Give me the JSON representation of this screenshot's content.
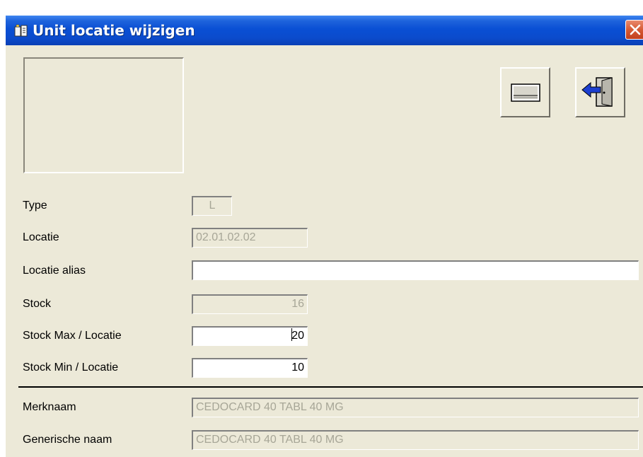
{
  "window": {
    "title": "Unit locatie wijzigen",
    "title_icon": "unit-location-icon",
    "close_icon": "close-icon"
  },
  "toolbar": {
    "save_icon": "save-icon",
    "exit_icon": "exit-door-icon"
  },
  "form": {
    "type": {
      "label": "Type",
      "value": "L"
    },
    "locatie": {
      "label": "Locatie",
      "value": "02.01.02.02"
    },
    "locatie_alias": {
      "label": "Locatie alias",
      "value": ""
    },
    "stock": {
      "label": "Stock",
      "value": "16"
    },
    "stock_max": {
      "label": "Stock Max / Locatie",
      "value": "20"
    },
    "stock_min": {
      "label": "Stock Min / Locatie",
      "value": "10"
    },
    "merknaam": {
      "label": "Merknaam",
      "value": "CEDOCARD 40 TABL 40 MG"
    },
    "generische_naam": {
      "label": "Generische naam",
      "value": "CEDOCARD 40 TABL 40 MG"
    }
  },
  "colors": {
    "titlebar": "#0a4fd4",
    "window_bg": "#ece9d8",
    "close_button": "#d65a34",
    "disabled_text": "#a7a697",
    "arrow_blue": "#1c3fd0"
  }
}
